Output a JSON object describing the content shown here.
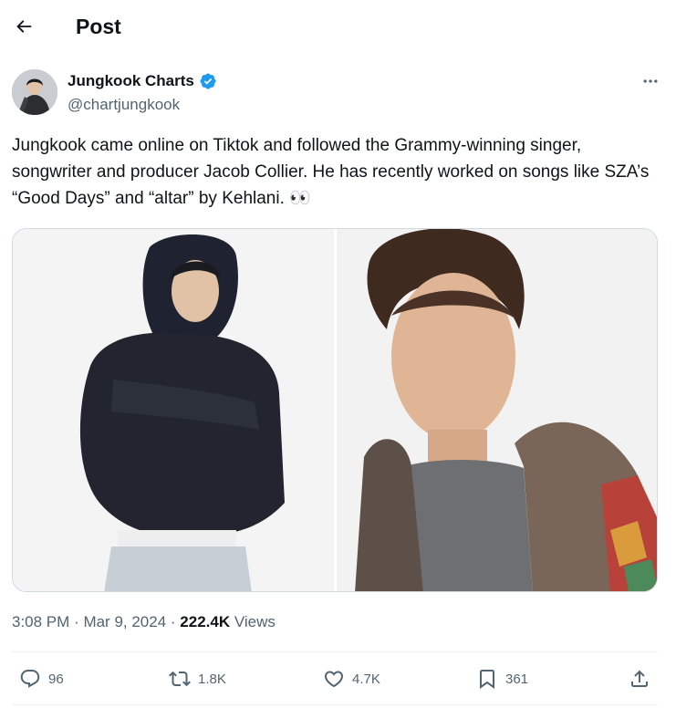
{
  "header": {
    "title": "Post"
  },
  "author": {
    "display_name": "Jungkook Charts",
    "handle": "@chartjungkook",
    "verified": true
  },
  "tweet": {
    "text": "Jungkook came online on Tiktok and followed the Grammy-winning singer, songwriter and producer Jacob Collier. He has recently worked on songs like SZA’s “Good Days” and “altar” by Kehlani. 👀",
    "media": [
      {
        "alt": "Photo of Jungkook in a black hoodie and Calvin Klein jeans"
      },
      {
        "alt": "Photo of Jacob Collier in a colorful knit cardigan"
      }
    ]
  },
  "meta": {
    "time": "3:08 PM",
    "date": "Mar 9, 2024",
    "views_count": "222.4K",
    "views_label": "Views"
  },
  "actions": {
    "replies": "96",
    "reposts": "1.8K",
    "likes": "4.7K",
    "bookmarks": "361"
  },
  "colors": {
    "text_primary": "#0f1419",
    "text_secondary": "#536471",
    "verified_blue": "#1d9bf0",
    "border": "#cfd9de",
    "divider": "#eff3f4"
  }
}
